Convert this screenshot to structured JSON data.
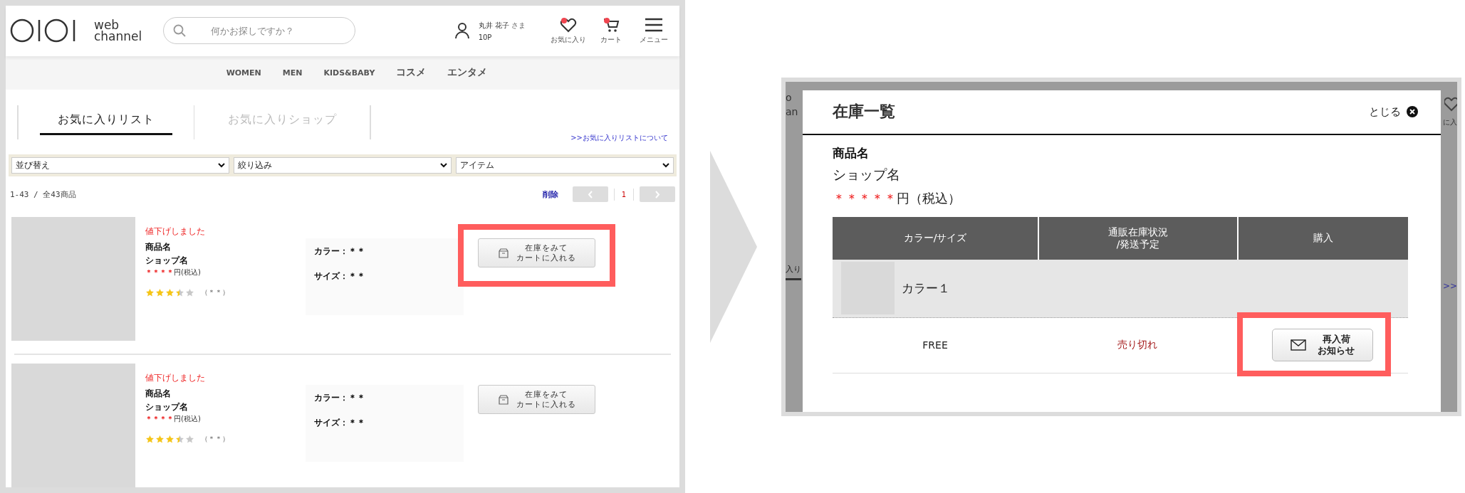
{
  "left_page": {
    "header": {
      "logo_text": "web\nchannel",
      "search": {
        "placeholder": "何かお探しですか？"
      },
      "user": {
        "name": "丸井 花子",
        "honorific": "さま",
        "points": "10P"
      },
      "icons": [
        {
          "kind": "heart",
          "label": "お気に入り",
          "badge": true
        },
        {
          "kind": "cart",
          "label": "カート",
          "badge": true
        },
        {
          "kind": "menu",
          "label": "メニュー",
          "badge": false
        }
      ]
    },
    "nav": [
      "WOMEN",
      "MEN",
      "KIDS&BABY",
      "コスメ",
      "エンタメ"
    ],
    "tabs": [
      {
        "label": "お気に入りリスト",
        "selected": true
      },
      {
        "label": "お気に入りショップ",
        "selected": false
      }
    ],
    "about_link": ">>お気に入りリストについて",
    "filters": [
      {
        "value": "並び替え"
      },
      {
        "value": "絞り込み"
      },
      {
        "value": "アイテム"
      }
    ],
    "count": "1-43 / 全43商品",
    "delete": "削除",
    "page": "1",
    "items": [
      {
        "notice": "値下げしました",
        "name": "商品名",
        "shop": "ショップ名",
        "price_mask": "＊＊＊＊",
        "price_suffix": "円(税込)",
        "stars": 3.5,
        "reviews": "（＊＊）",
        "options": [
          "カラー：＊＊",
          "サイズ：＊＊"
        ],
        "button": [
          "在庫をみて",
          "カートに入れる"
        ],
        "highlighted": true
      },
      {
        "notice": "値下げしました",
        "name": "商品名",
        "shop": "ショップ名",
        "price_mask": "＊＊＊＊",
        "price_suffix": "円(税込)",
        "stars": 3.5,
        "reviews": "（＊＊）",
        "options": [
          "カラー：＊＊",
          "サイズ：＊＊"
        ],
        "button": [
          "在庫をみて",
          "カートに入れる"
        ],
        "highlighted": false
      }
    ]
  },
  "backdrop_fragments": {
    "logo": "o\nan",
    "icon_label": "に入",
    "tab": "入り",
    "link": ">>"
  },
  "modal": {
    "title": "在庫一覧",
    "close": "とじる",
    "name": "商品名",
    "shop": "ショップ名",
    "price_mask": "＊＊＊＊＊",
    "price_suffix": "円（税込）",
    "columns": [
      "カラー/サイズ",
      "通販在庫状況\n/発送予定",
      "購入"
    ],
    "color_label": "カラー１",
    "rows": [
      {
        "size": "FREE",
        "status": "売り切れ",
        "button": [
          "再入荷",
          "お知らせ"
        ],
        "highlighted": true
      }
    ]
  }
}
